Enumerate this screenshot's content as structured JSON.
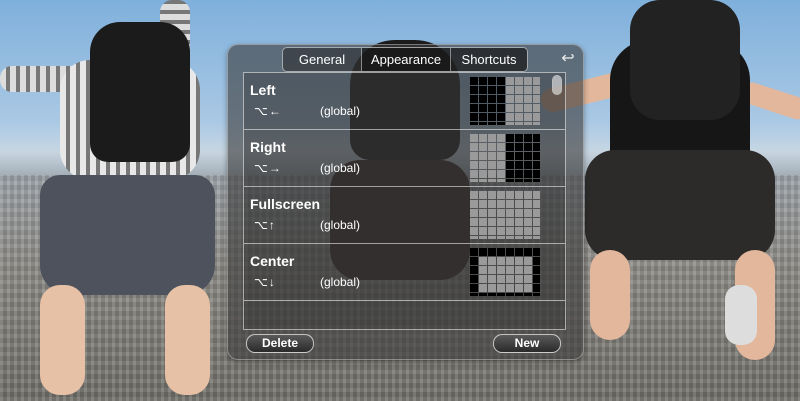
{
  "tabs": [
    "General",
    "Appearance",
    "Shortcuts"
  ],
  "selected_tab": "Shortcuts",
  "undo_icon": "undo-arrow-icon",
  "shortcuts": [
    {
      "name": "Left",
      "keys": "⌥←",
      "scope": "(global)",
      "preview": "left-half"
    },
    {
      "name": "Right",
      "keys": "⌥→",
      "scope": "(global)",
      "preview": "right-half"
    },
    {
      "name": "Fullscreen",
      "keys": "⌥↑",
      "scope": "(global)",
      "preview": "full"
    },
    {
      "name": "Center",
      "keys": "⌥↓",
      "scope": "(global)",
      "preview": "center"
    }
  ],
  "buttons": {
    "delete": "Delete",
    "new": "New"
  },
  "colors": {
    "panel": "#3c3c3c",
    "cell_filled": "#000000",
    "cell_empty": "#9a9a9a"
  }
}
